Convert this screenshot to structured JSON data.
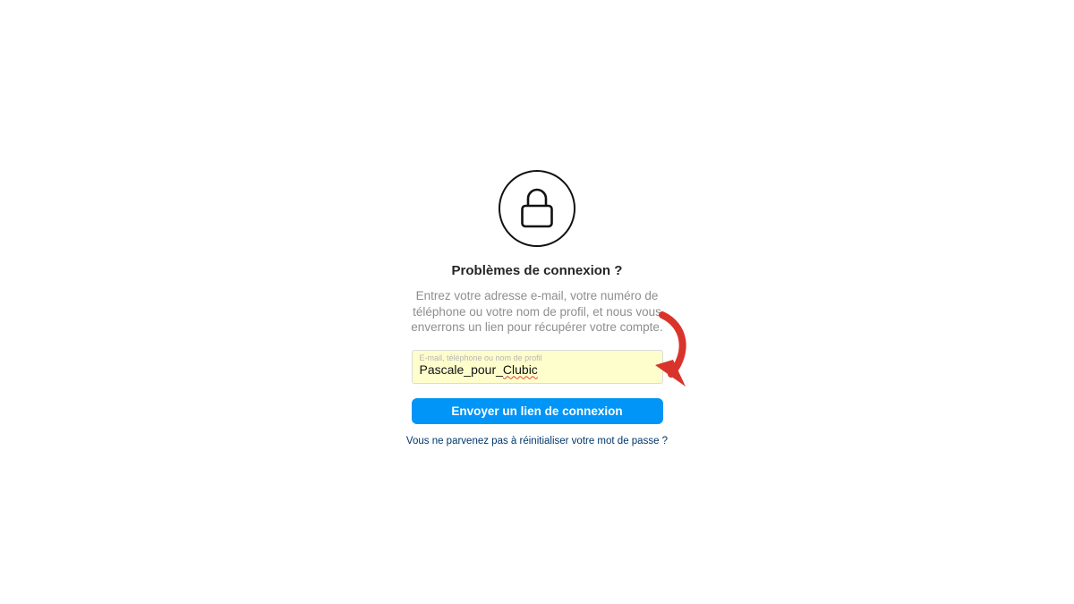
{
  "header": {
    "icon": "lock-icon",
    "title": "Problèmes de connexion ?"
  },
  "description": "Entrez votre adresse e-mail, votre numéro de téléphone ou votre nom de profil, et nous vous enverrons un lien pour récupérer votre compte.",
  "form": {
    "field_label": "E-mail, téléphone ou nom de profil",
    "field_value_prefix": "Pascale_pour_",
    "field_value_misspelled": "Clubic",
    "field_background": "#fefecc",
    "submit_label": "Envoyer un lien de connexion",
    "submit_color": "#0095f6"
  },
  "help_link": "Vous ne parvenez pas à réinitialiser votre mot de passe ?",
  "annotation": {
    "icon": "curved-arrow-icon",
    "color": "#d9342b"
  }
}
